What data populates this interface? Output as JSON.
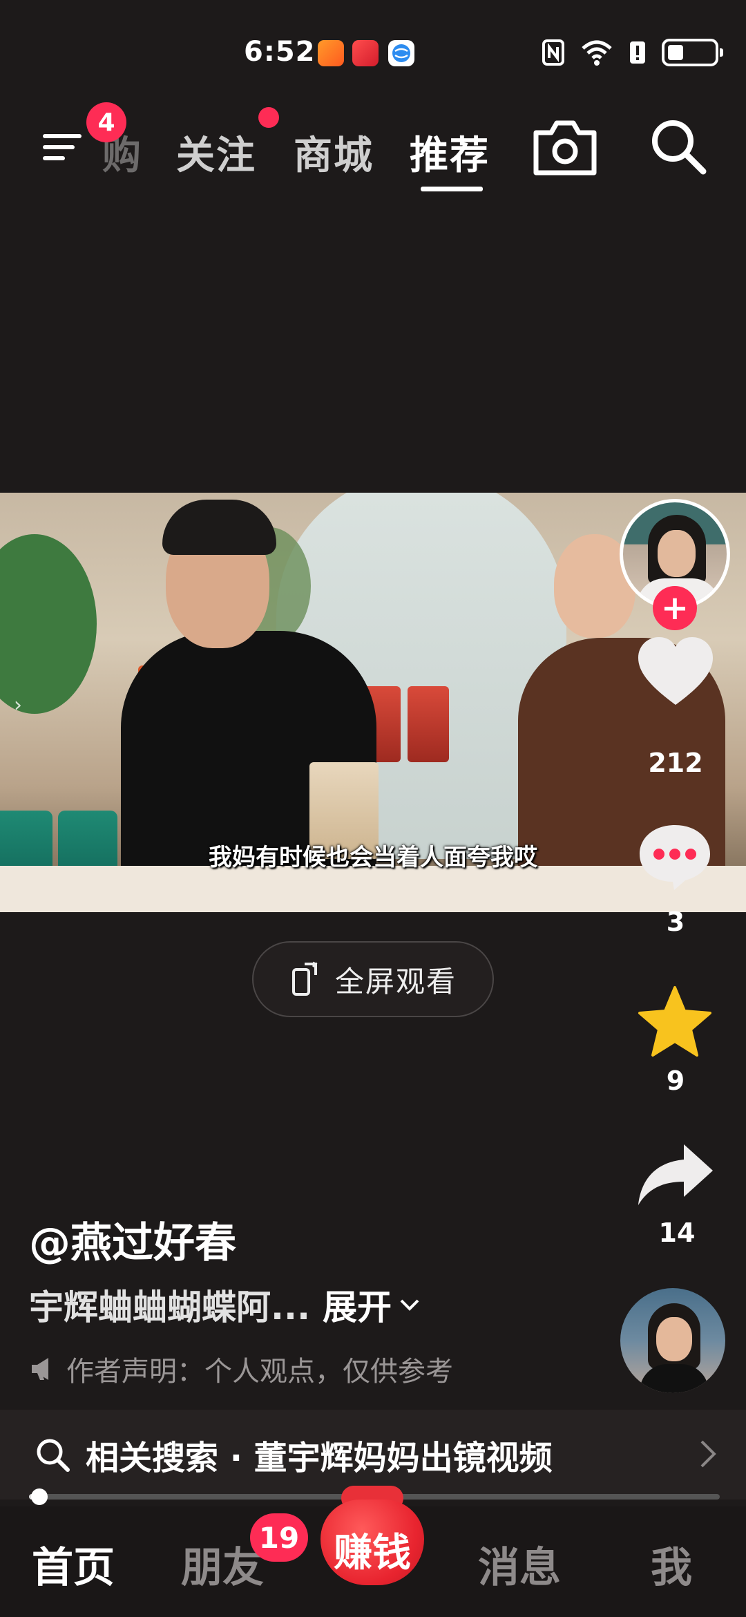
{
  "status_bar": {
    "time": "6:52",
    "app_icons": [
      "kuaishou-app-icon",
      "reader-app-icon",
      "browser-app-icon"
    ],
    "icons": [
      "nfc-icon",
      "wifi-icon",
      "alert-icon",
      "battery-icon"
    ],
    "battery_level": 0.35
  },
  "top_nav": {
    "menu_badge": "4",
    "tabs": [
      {
        "label": "购",
        "state": "faded"
      },
      {
        "label": "关注",
        "state": "normal",
        "has_dot": true
      },
      {
        "label": "商城",
        "state": "normal"
      },
      {
        "label": "推荐",
        "state": "active"
      }
    ]
  },
  "video": {
    "subtitle": "我妈有时候也会当着人面夸我哎"
  },
  "fullscreen_button": {
    "label": "全屏观看"
  },
  "right_rail": {
    "like_count": "212",
    "comment_count": "3",
    "favorite_count": "9",
    "share_count": "14"
  },
  "post": {
    "author": "@燕过好春",
    "caption": "宇辉蛐蛐蝴蝶阿...",
    "expand_label": "展开",
    "declaration": "作者声明：个人观点，仅供参考"
  },
  "related_search": {
    "text": "相关搜索 · 董宇辉妈妈出镜视频"
  },
  "progress": {
    "value": 0.015
  },
  "bottom_nav": {
    "items": [
      "首页",
      "朋友",
      "赚钱",
      "消息",
      "我"
    ],
    "friends_badge": "19"
  },
  "colors": {
    "accent": "#fe2c55",
    "background": "#1d1a1a",
    "favorite": "#f8c31e"
  }
}
